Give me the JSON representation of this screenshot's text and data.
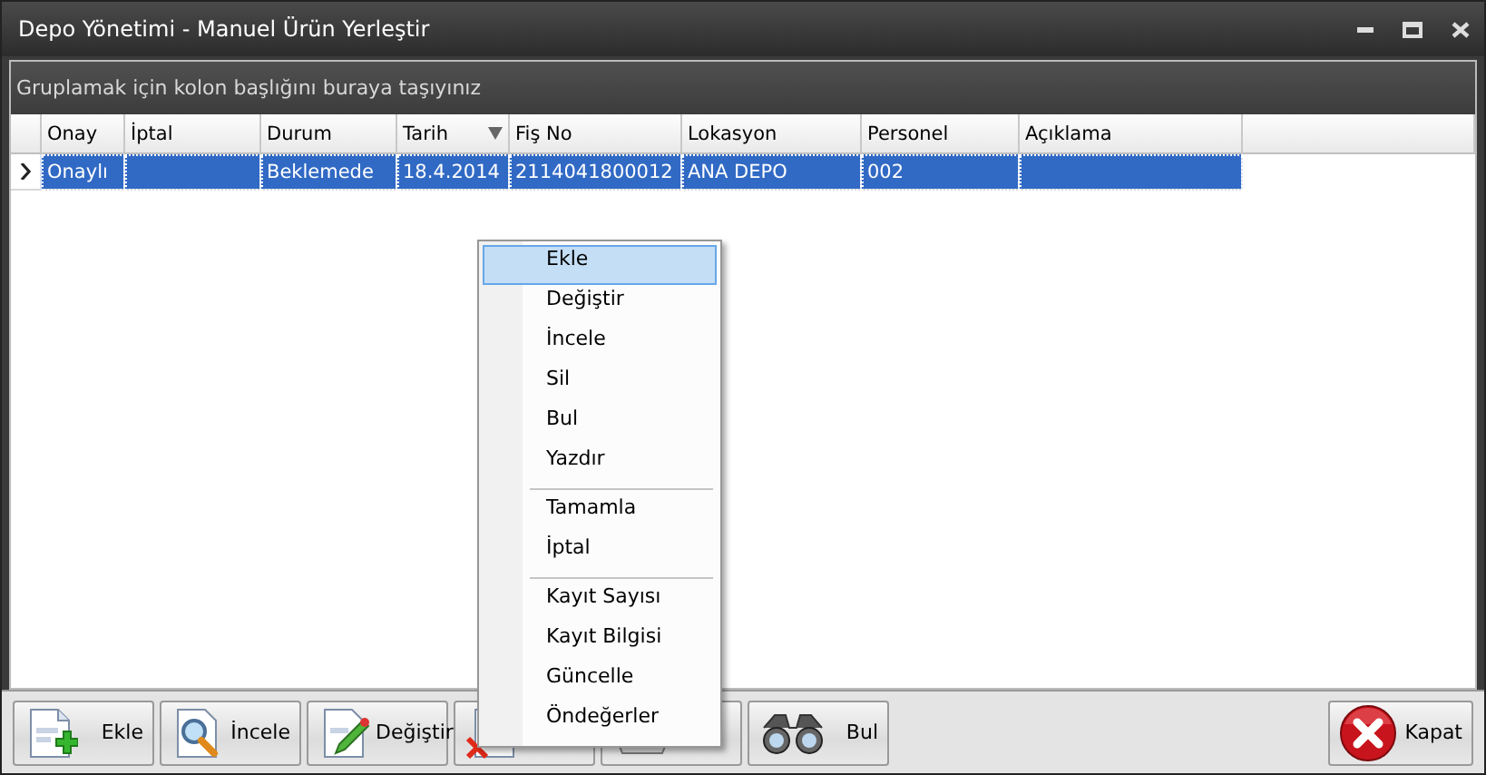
{
  "window": {
    "title": "Depo Yönetimi - Manuel Ürün Yerleştir"
  },
  "group_panel": {
    "hint": "Gruplamak için kolon başlığını buraya taşıyınız"
  },
  "grid": {
    "columns": [
      {
        "label": "Onay",
        "sorted": false
      },
      {
        "label": "İptal",
        "sorted": false
      },
      {
        "label": "Durum",
        "sorted": false
      },
      {
        "label": "Tarih",
        "sorted": true
      },
      {
        "label": "Fiş No",
        "sorted": false
      },
      {
        "label": "Lokasyon",
        "sorted": false
      },
      {
        "label": "Personel",
        "sorted": false
      },
      {
        "label": "Açıklama",
        "sorted": false
      }
    ],
    "rows": [
      {
        "selected": true,
        "cells": [
          "Onaylı",
          null,
          "Beklemede",
          "18.4.2014",
          "2114041800012",
          "ANA DEPO",
          "002",
          null
        ]
      }
    ]
  },
  "context_menu": {
    "items": [
      {
        "kind": "item",
        "label": "Ekle",
        "selected": true
      },
      {
        "kind": "item",
        "label": "Değiştir",
        "selected": false
      },
      {
        "kind": "item",
        "label": "İncele",
        "selected": false
      },
      {
        "kind": "item",
        "label": "Sil",
        "selected": false
      },
      {
        "kind": "item",
        "label": "Bul",
        "selected": false
      },
      {
        "kind": "item",
        "label": "Yazdır",
        "selected": false
      },
      {
        "kind": "separator"
      },
      {
        "kind": "item",
        "label": "Tamamla",
        "selected": false
      },
      {
        "kind": "item",
        "label": "İptal",
        "selected": false
      },
      {
        "kind": "separator"
      },
      {
        "kind": "item",
        "label": "Kayıt Sayısı",
        "selected": false
      },
      {
        "kind": "item",
        "label": "Kayıt Bilgisi",
        "selected": false
      },
      {
        "kind": "item",
        "label": "Güncelle",
        "selected": false
      },
      {
        "kind": "item",
        "label": "Öndeğerler",
        "selected": false
      }
    ]
  },
  "buttons": [
    {
      "kind": "add",
      "label": "Ekle"
    },
    {
      "kind": "view",
      "label": "İncele"
    },
    {
      "kind": "edit",
      "label": "Değiştir"
    },
    {
      "kind": "delete"
    },
    {
      "kind": "print"
    },
    {
      "kind": "find",
      "label": "Bul"
    }
  ],
  "close_button": {
    "kind": "close",
    "label": "Kapat"
  }
}
